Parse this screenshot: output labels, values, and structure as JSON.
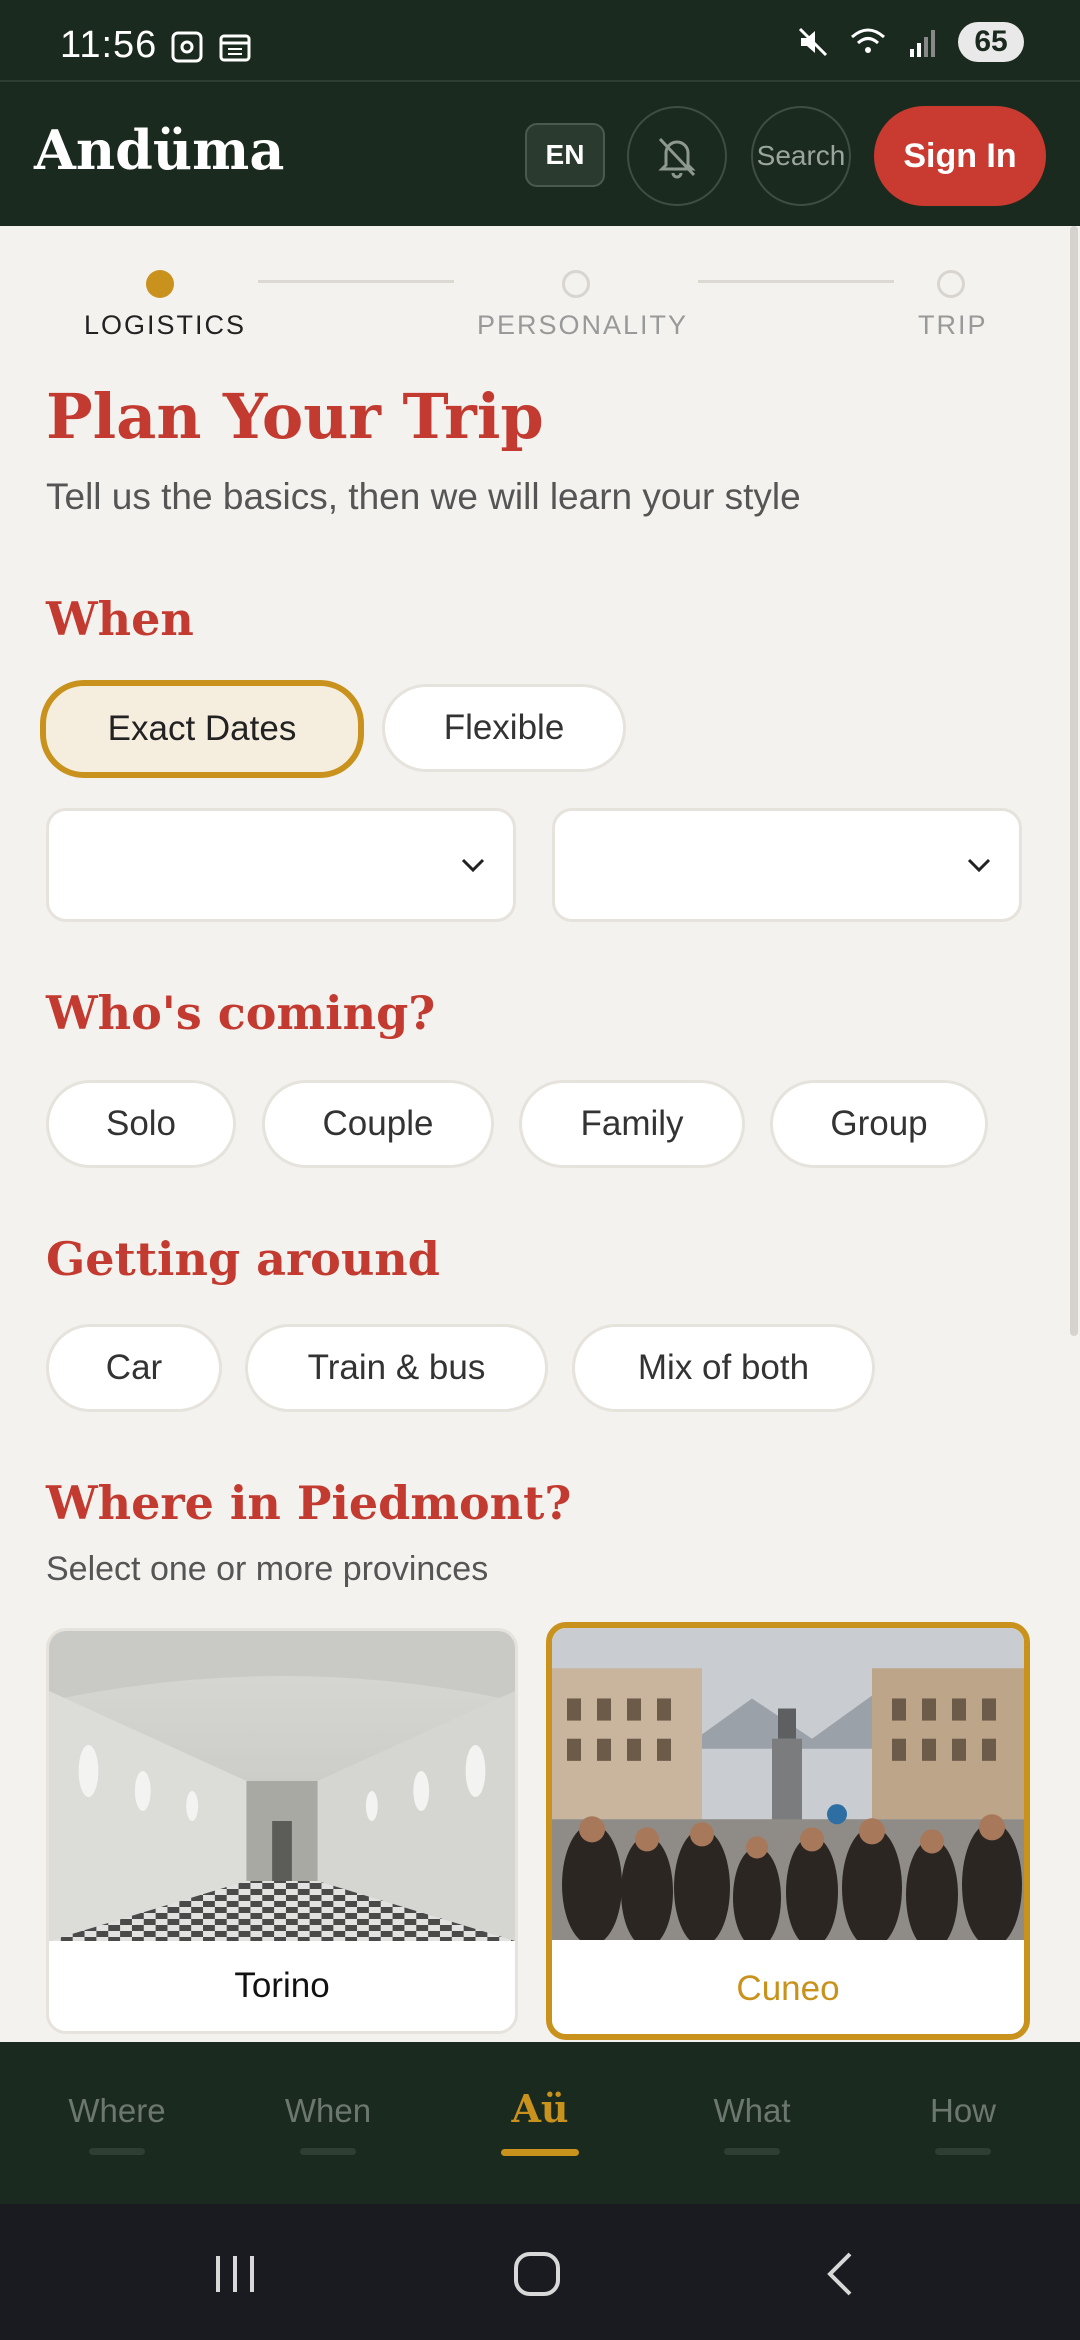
{
  "status_bar": {
    "time": "11:56",
    "battery": "65"
  },
  "header": {
    "brand": "Andüma",
    "language": "EN",
    "search_label": "Search",
    "sign_in": "Sign In"
  },
  "stepper": {
    "steps": [
      {
        "label": "LOGISTICS",
        "active": true
      },
      {
        "label": "PERSONALITY",
        "active": false
      },
      {
        "label": "TRIP",
        "active": false
      }
    ]
  },
  "page": {
    "title": "Plan Your Trip",
    "subtitle": "Tell us the basics, then we will learn your style"
  },
  "when": {
    "title": "When",
    "options": [
      "Exact Dates",
      "Flexible"
    ],
    "selected": "Exact Dates",
    "start_select": "",
    "end_select": ""
  },
  "who": {
    "title": "Who's coming?",
    "options": [
      "Solo",
      "Couple",
      "Family",
      "Group"
    ]
  },
  "getting_around": {
    "title": "Getting around",
    "options": [
      "Car",
      "Train & bus",
      "Mix of both"
    ]
  },
  "where": {
    "title": "Where in Piedmont?",
    "subtitle": "Select one or more provinces",
    "provinces": [
      {
        "name": "Torino",
        "selected": false
      },
      {
        "name": "Cuneo",
        "selected": true
      }
    ]
  },
  "bottom_nav": {
    "items": [
      "Where",
      "When",
      "Aü",
      "What",
      "How"
    ],
    "active": "Aü"
  },
  "colors": {
    "dark_green": "#1b2a1e",
    "accent_red": "#c23a30",
    "accent_gold": "#c8921c",
    "background": "#f4f2ee"
  }
}
